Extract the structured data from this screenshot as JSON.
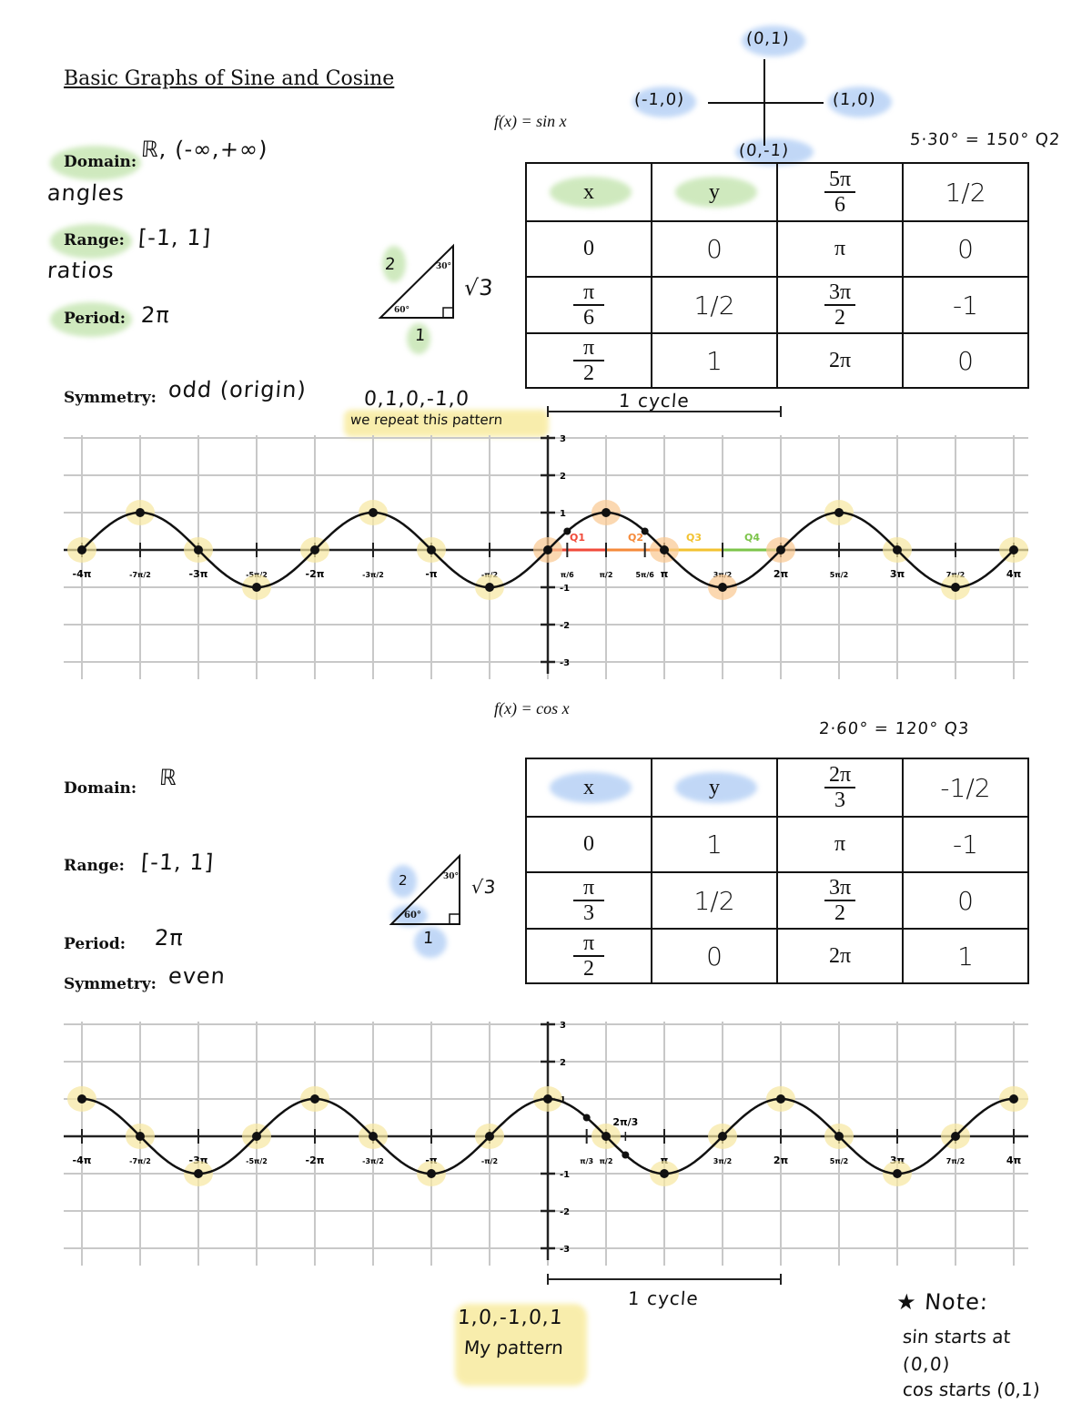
{
  "title": "Basic Graphs of Sine and Cosine",
  "sine": {
    "function": "f(x) = sin x",
    "unit_circle": {
      "top": "(0,1)",
      "left": "(-1,0)",
      "right": "(1,0)",
      "bottom": "(0,-1)"
    },
    "angle_note": "5·30° = 150° Q2",
    "domain_label": "Domain:",
    "domain_value": "ℝ, (-∞,+∞)",
    "domain_note": "angles",
    "range_label": "Range:",
    "range_value": "[-1, 1]",
    "range_note": "ratios",
    "period_label": "Period:",
    "period_value": "2π",
    "symmetry_label": "Symmetry:",
    "symmetry_value": "odd (origin)",
    "pattern": "0,1,0,-1,0",
    "pattern_note": "we repeat this pattern",
    "cycle": "1 cycle",
    "triangle": {
      "hyp": "2",
      "top_angle": "30°",
      "long_leg": "√3",
      "bottom_angle": "60°",
      "short_leg": "1"
    },
    "table": {
      "header": [
        "x",
        "y",
        "5π/6",
        "1/2"
      ],
      "rows": [
        [
          "0",
          "0",
          "π",
          "0"
        ],
        [
          "π/6",
          "1/2",
          "3π/2",
          "-1"
        ],
        [
          "π/2",
          "1",
          "2π",
          "0"
        ]
      ]
    },
    "highlight": "#a8d88a"
  },
  "cosine": {
    "function": "f(x) = cos x",
    "angle_note": "2·60° = 120° Q3",
    "domain_label": "Domain:",
    "domain_value": "ℝ",
    "range_label": "Range:",
    "range_value": "[-1, 1]",
    "period_label": "Period:",
    "period_value": "2π",
    "symmetry_label": "Symmetry:",
    "symmetry_value": "even",
    "pattern": "1,0,-1,0,1",
    "pattern_note": "My pattern",
    "cycle": "1 cycle",
    "triangle": {
      "hyp": "2",
      "top_angle": "30°",
      "long_leg": "√3",
      "bottom_angle": "60°",
      "short_leg": "1"
    },
    "table": {
      "header": [
        "x",
        "y",
        "2π/3",
        "-1/2"
      ],
      "rows": [
        [
          "0",
          "1",
          "π",
          "-1"
        ],
        [
          "π/3",
          "1/2",
          "3π/2",
          "0"
        ],
        [
          "π/2",
          "0",
          "2π",
          "1"
        ]
      ]
    },
    "highlight": "#8fb8f0"
  },
  "note": {
    "title": "★ Note:",
    "lines": [
      "sin starts at",
      "(0,0)",
      "cos starts (0,1)"
    ]
  },
  "chart_data": [
    {
      "type": "line",
      "function": "sin",
      "xlim": [
        "-4π",
        "4π"
      ],
      "ylim": [
        -3,
        3
      ],
      "grid": true,
      "x_ticks": [
        "-4π",
        "-7π/2",
        "-3π",
        "-5π/2",
        "-2π",
        "-3π/2",
        "-π",
        "-π/2",
        "π/6",
        "π/2",
        "5π/6",
        "π",
        "3π/2",
        "2π",
        "5π/2",
        "3π",
        "7π/2",
        "4π"
      ],
      "y_ticks": [
        "3",
        "2",
        "1",
        "-1",
        "-2",
        "-3"
      ],
      "points": [
        {
          "x": "-4π",
          "y": 0
        },
        {
          "x": "-7π/2",
          "y": 1
        },
        {
          "x": "-3π",
          "y": 0
        },
        {
          "x": "-5π/2",
          "y": -1
        },
        {
          "x": "-2π",
          "y": 0
        },
        {
          "x": "-3π/2",
          "y": 1
        },
        {
          "x": "-π",
          "y": 0
        },
        {
          "x": "-π/2",
          "y": -1
        },
        {
          "x": "0",
          "y": 0
        },
        {
          "x": "π/6",
          "y": 0.5
        },
        {
          "x": "π/2",
          "y": 1
        },
        {
          "x": "5π/6",
          "y": 0.5
        },
        {
          "x": "π",
          "y": 0
        },
        {
          "x": "3π/2",
          "y": -1
        },
        {
          "x": "2π",
          "y": 0
        },
        {
          "x": "5π/2",
          "y": 1
        },
        {
          "x": "3π",
          "y": 0
        },
        {
          "x": "7π/2",
          "y": -1
        },
        {
          "x": "4π",
          "y": 0
        }
      ],
      "quadrants": [
        {
          "label": "Q1",
          "color": "#f04a3a"
        },
        {
          "label": "Q2",
          "color": "#f58a3a"
        },
        {
          "label": "Q3",
          "color": "#f2c230"
        },
        {
          "label": "Q4",
          "color": "#7cc44a"
        }
      ]
    },
    {
      "type": "line",
      "function": "cos",
      "xlim": [
        "-4π",
        "4π"
      ],
      "ylim": [
        -3,
        3
      ],
      "grid": true,
      "x_ticks": [
        "-4π",
        "-7π/2",
        "-3π",
        "-5π/2",
        "-2π",
        "-3π/2",
        "-π",
        "-π/2",
        "π/3",
        "π/2",
        "π",
        "3π/2",
        "2π",
        "5π/2",
        "3π",
        "7π/2",
        "4π"
      ],
      "y_ticks": [
        "3",
        "2",
        "1",
        "-1",
        "-2",
        "-3"
      ],
      "annotation": "2π/3",
      "points": [
        {
          "x": "-4π",
          "y": 1
        },
        {
          "x": "-7π/2",
          "y": 0
        },
        {
          "x": "-3π",
          "y": -1
        },
        {
          "x": "-5π/2",
          "y": 0
        },
        {
          "x": "-2π",
          "y": 1
        },
        {
          "x": "-3π/2",
          "y": 0
        },
        {
          "x": "-π",
          "y": -1
        },
        {
          "x": "-π/2",
          "y": 0
        },
        {
          "x": "0",
          "y": 1
        },
        {
          "x": "π/3",
          "y": 0.5
        },
        {
          "x": "π/2",
          "y": 0
        },
        {
          "x": "2π/3",
          "y": -0.5
        },
        {
          "x": "π",
          "y": -1
        },
        {
          "x": "3π/2",
          "y": 0
        },
        {
          "x": "2π",
          "y": 1
        },
        {
          "x": "5π/2",
          "y": 0
        },
        {
          "x": "3π",
          "y": -1
        },
        {
          "x": "7π/2",
          "y": 0
        },
        {
          "x": "4π",
          "y": 1
        }
      ]
    }
  ]
}
